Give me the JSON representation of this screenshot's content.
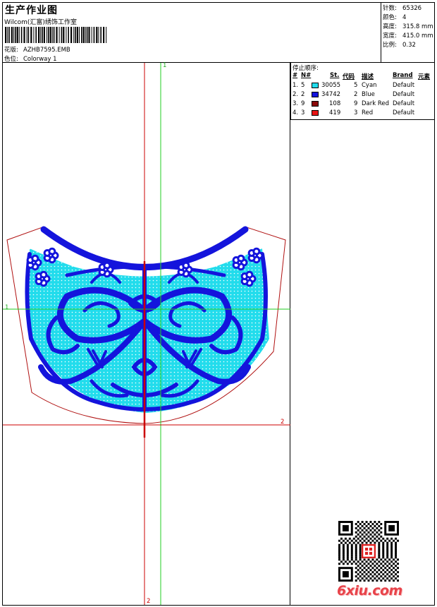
{
  "header": {
    "title": "生产作业图",
    "studio": "Wilcom(汇富)绣饰工作室",
    "design_label": "花版:",
    "design_value": "AZHB7595.EMB",
    "colorway_label": "色位:",
    "colorway_value": "Colorway 1"
  },
  "stats": [
    {
      "label": "针数:",
      "value": "65326"
    },
    {
      "label": "颜色:",
      "value": "4"
    },
    {
      "label": "高度:",
      "value": "315.8 mm"
    },
    {
      "label": "宽度:",
      "value": "415.0 mm"
    },
    {
      "label": "比例:",
      "value": "0.32"
    }
  ],
  "stop_sequence": {
    "title": "停止顺序:",
    "columns": [
      "#",
      "N#",
      "St.",
      "代码",
      "描述",
      "Brand",
      "元素"
    ],
    "rows": [
      {
        "num": "1.",
        "n": "5",
        "st": "30055",
        "code": "5",
        "desc": "Cyan",
        "brand": "Default",
        "color": "#22dcec"
      },
      {
        "num": "2.",
        "n": "2",
        "st": "34742",
        "code": "2",
        "desc": "Blue",
        "brand": "Default",
        "color": "#1414dc"
      },
      {
        "num": "3.",
        "n": "9",
        "st": "108",
        "code": "9",
        "desc": "Dark Red",
        "brand": "Default",
        "color": "#8b0a0a"
      },
      {
        "num": "4.",
        "n": "3",
        "st": "419",
        "code": "3",
        "desc": "Red",
        "brand": "Default",
        "color": "#e81414"
      }
    ]
  },
  "axes": {
    "v1": "1",
    "h1": "1",
    "h2": "2",
    "v2": "2"
  },
  "footer": {
    "brand": "6xiu.com"
  },
  "colors": {
    "cyan": "#22dcec",
    "blue": "#1414dc",
    "red": "#cc0000",
    "green": "#22cc22",
    "outline": "#b01010"
  }
}
